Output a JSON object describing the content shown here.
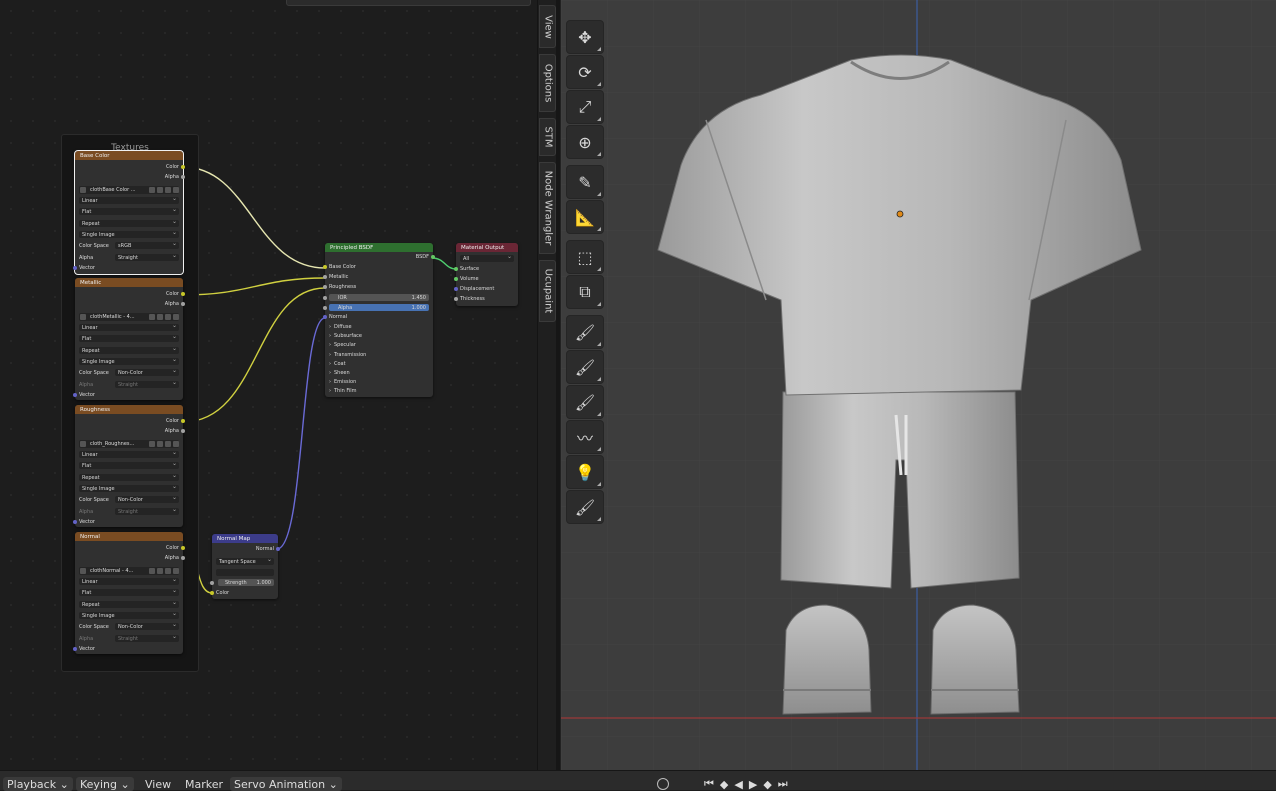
{
  "node_editor": {
    "frame_title": "Textures",
    "texture_nodes": [
      {
        "title": "Base Color",
        "image": "clothBase Color ...",
        "interpolation": "Linear",
        "projection": "Flat",
        "extension": "Repeat",
        "source": "Single Image",
        "color_space_label": "Color Space",
        "color_space": "sRGB",
        "alpha_label": "Alpha",
        "alpha_mode": "Straight",
        "out_color": "Color",
        "out_alpha": "Alpha",
        "in_vector": "Vector"
      },
      {
        "title": "Metallic",
        "image": "clothMetallic - 4...",
        "interpolation": "Linear",
        "projection": "Flat",
        "extension": "Repeat",
        "source": "Single Image",
        "color_space_label": "Color Space",
        "color_space": "Non-Color",
        "alpha_label": "Alpha",
        "alpha_mode": "Straight",
        "out_color": "Color",
        "out_alpha": "Alpha",
        "in_vector": "Vector"
      },
      {
        "title": "Roughness",
        "image": "cloth_Roughnes...",
        "interpolation": "Linear",
        "projection": "Flat",
        "extension": "Repeat",
        "source": "Single Image",
        "color_space_label": "Color Space",
        "color_space": "Non-Color",
        "alpha_label": "Alpha",
        "alpha_mode": "Straight",
        "out_color": "Color",
        "out_alpha": "Alpha",
        "in_vector": "Vector"
      },
      {
        "title": "Normal",
        "image": "clothNormal - 4...",
        "interpolation": "Linear",
        "projection": "Flat",
        "extension": "Repeat",
        "source": "Single Image",
        "color_space_label": "Color Space",
        "color_space": "Non-Color",
        "alpha_label": "Alpha",
        "alpha_mode": "Straight",
        "out_color": "Color",
        "out_alpha": "Alpha",
        "in_vector": "Vector"
      }
    ],
    "principled": {
      "title": "Principled BSDF",
      "out": "BSDF",
      "base_color": "Base Color",
      "metallic": "Metallic",
      "roughness": "Roughness",
      "ior_label": "IOR",
      "ior_value": "1.450",
      "alpha_label": "Alpha",
      "alpha_value": "1.000",
      "normal": "Normal",
      "panels": [
        "Diffuse",
        "Subsurface",
        "Specular",
        "Transmission",
        "Coat",
        "Sheen",
        "Emission",
        "Thin Film"
      ]
    },
    "material_output": {
      "title": "Material Output",
      "target": "All",
      "surface": "Surface",
      "volume": "Volume",
      "displacement": "Displacement",
      "thickness": "Thickness"
    },
    "normal_map": {
      "title": "Normal Map",
      "out": "Normal",
      "space": "Tangent Space",
      "uv": "",
      "strength_label": "Strength",
      "strength_value": "1.000",
      "in_color": "Color"
    }
  },
  "sidebar_tabs": [
    "View",
    "Options",
    "STM",
    "Node Wrangler",
    "Ucupaint"
  ],
  "timeline": {
    "playback": "Playback",
    "keying": "Keying",
    "view": "View",
    "marker": "Marker",
    "action": "Servo Animation"
  },
  "toolbar_icons": [
    "move-icon",
    "rotate-icon",
    "scale-icon",
    "transform-icon",
    "annotate-icon",
    "measure-icon",
    "add-cube-icon",
    "add-object-icon",
    "paint-brush-icon",
    "vertex-paint-icon",
    "weight-paint-icon",
    "smooth-brush-icon",
    "bulb-paint-icon",
    "mask-brush-icon"
  ],
  "colors": {
    "texture_header": "#7a4c22",
    "shader_header": "#2e6f2f",
    "output_header": "#6a2635",
    "vector_header": "#3c3c8a",
    "link_yellow": "#c7c729",
    "link_gray": "#a1a1a1",
    "link_vector": "#6363c7",
    "viewport_bg": "#3d3d3d"
  }
}
